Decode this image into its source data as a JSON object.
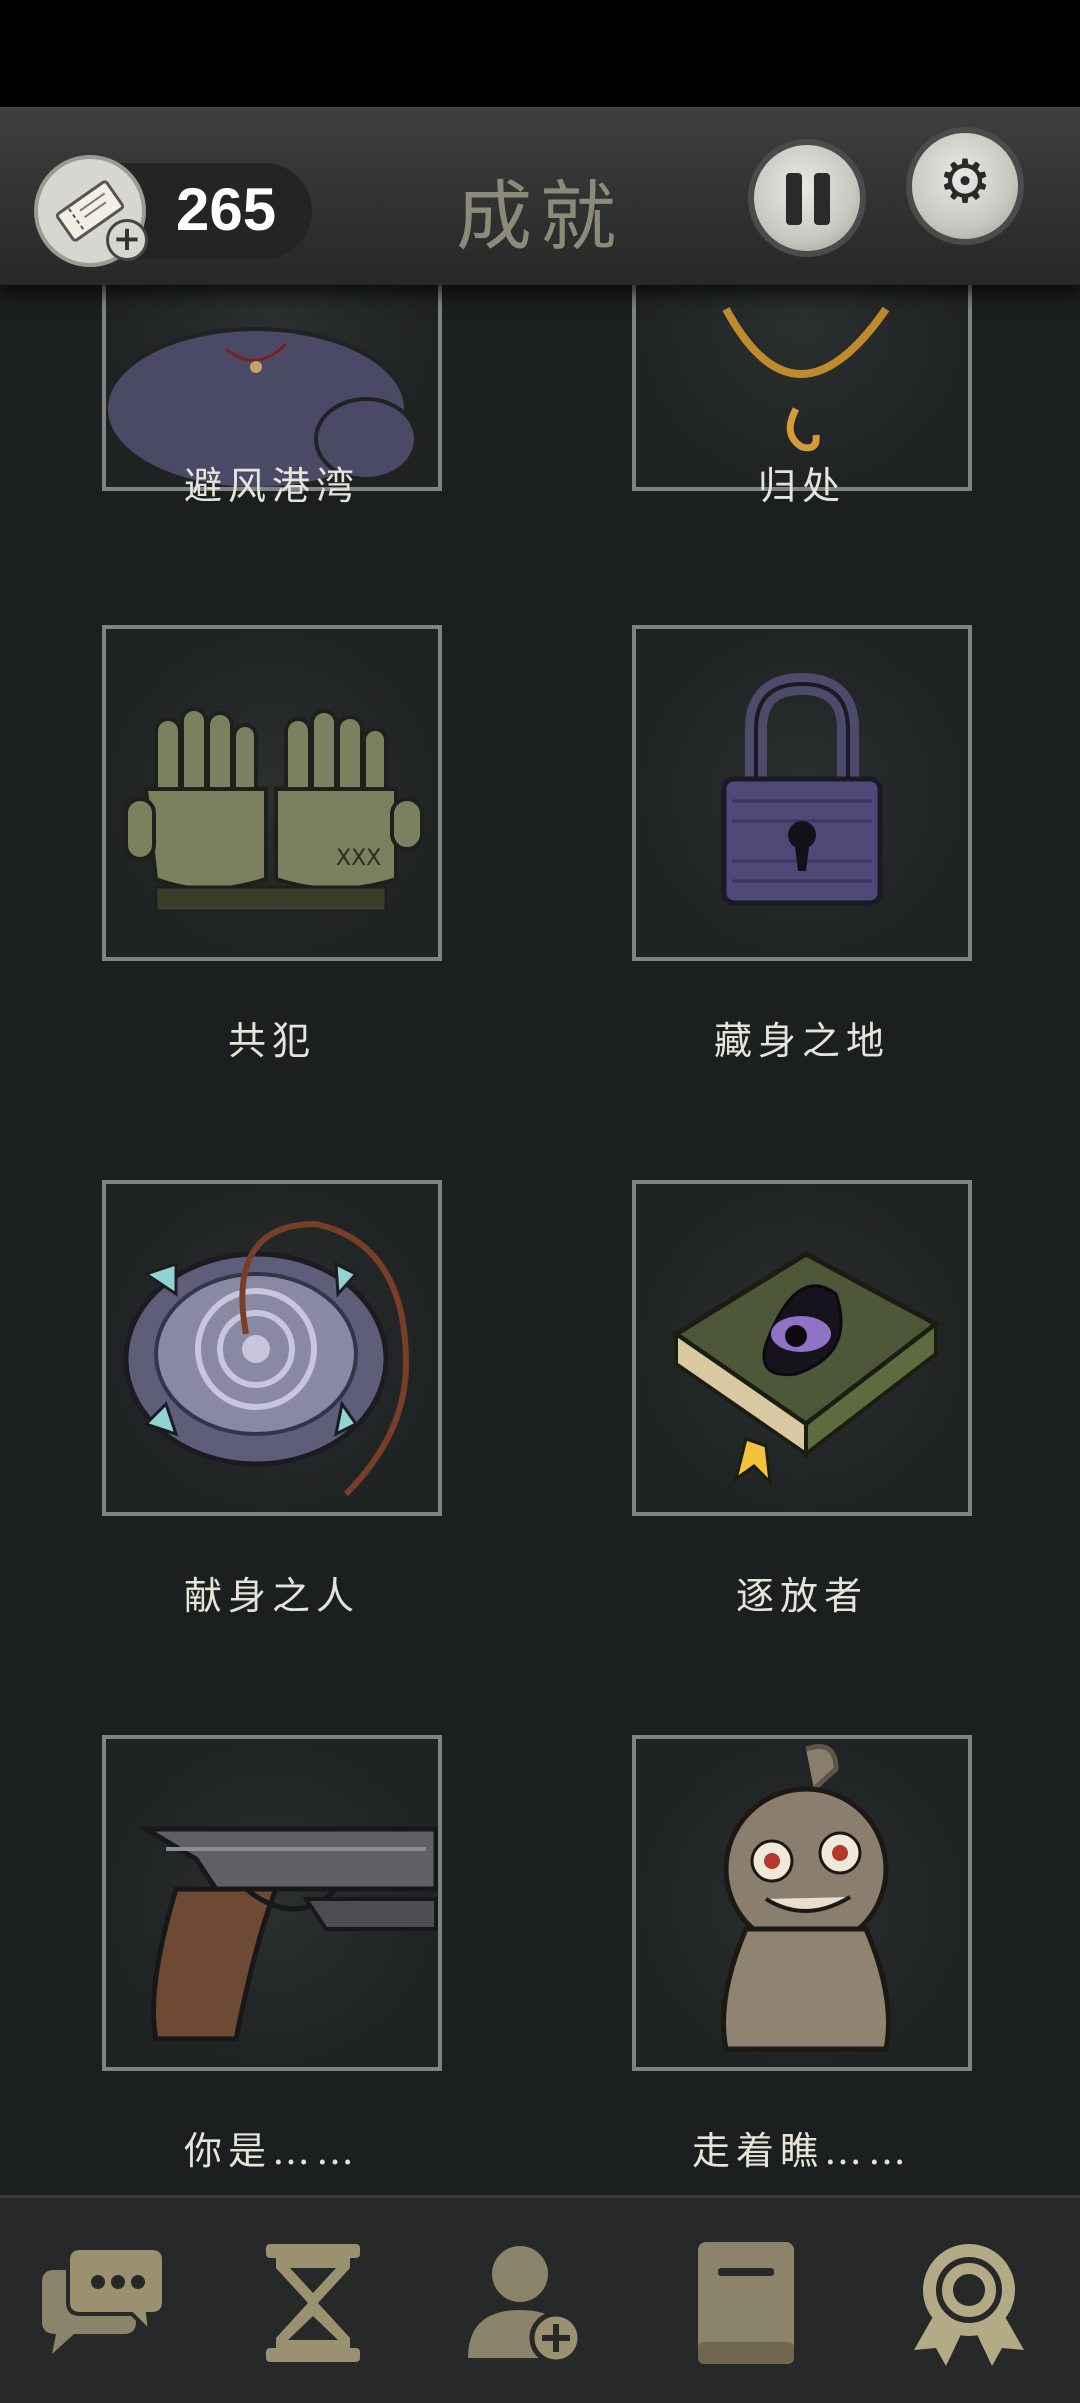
{
  "header": {
    "title": "成就",
    "ticket_count": "265"
  },
  "icons": {
    "ticket": "ticket-icon",
    "add": "plus-icon",
    "pause": "pause-icon",
    "settings": "gear-icon"
  },
  "achievements": [
    {
      "label": "避风港湾",
      "icon": "cat-icon"
    },
    {
      "label": "归处",
      "icon": "necklace-icon"
    },
    {
      "label": "共犯",
      "icon": "gloves-icon"
    },
    {
      "label": "藏身之地",
      "icon": "padlock-icon"
    },
    {
      "label": "献身之人",
      "icon": "amulet-icon"
    },
    {
      "label": "逐放者",
      "icon": "eye-book-icon"
    },
    {
      "label": "你是……",
      "icon": "pistol-icon"
    },
    {
      "label": "走着瞧……",
      "icon": "doll-icon"
    }
  ],
  "bottom_nav": [
    {
      "name": "chat",
      "icon": "chat-icon"
    },
    {
      "name": "time",
      "icon": "hourglass-icon"
    },
    {
      "name": "add-contact",
      "icon": "add-user-icon"
    },
    {
      "name": "journal",
      "icon": "book-icon"
    },
    {
      "name": "achievements",
      "icon": "medal-icon",
      "active": true
    }
  ],
  "colors": {
    "background": "#1c1f1f",
    "header": "#2e3130",
    "title": "#8d8a78",
    "nav_icon": "#9a9170",
    "card_border": "#7f8483"
  }
}
